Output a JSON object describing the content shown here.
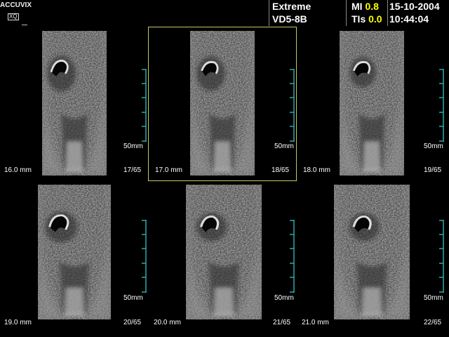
{
  "header": {
    "logo_main": "ACCUVIX",
    "logo_sub": "XQ",
    "preset": "Extreme",
    "probe": "VD5-8B",
    "mi_label": "MI",
    "mi_value": "0.8",
    "tis_label": "TIs",
    "tis_value": "0.0",
    "date": "15-10-2004",
    "time": "10:44:04"
  },
  "frames": [
    {
      "depth": "16.0 mm",
      "index": "17/65",
      "scale": "50mm",
      "selected": false
    },
    {
      "depth": "17.0 mm",
      "index": "18/65",
      "scale": "50mm",
      "selected": true
    },
    {
      "depth": "18.0 mm",
      "index": "19/65",
      "scale": "50mm",
      "selected": false
    },
    {
      "depth": "19.0 mm",
      "index": "20/65",
      "scale": "50mm",
      "selected": false
    },
    {
      "depth": "20.0 mm",
      "index": "21/65",
      "scale": "50mm",
      "selected": false
    },
    {
      "depth": "21.0 mm",
      "index": "22/65",
      "scale": "50mm",
      "selected": false
    }
  ],
  "colors": {
    "scale_marker": "#2fa8a8",
    "highlight": "#c8c860",
    "values": "#ffff00"
  }
}
